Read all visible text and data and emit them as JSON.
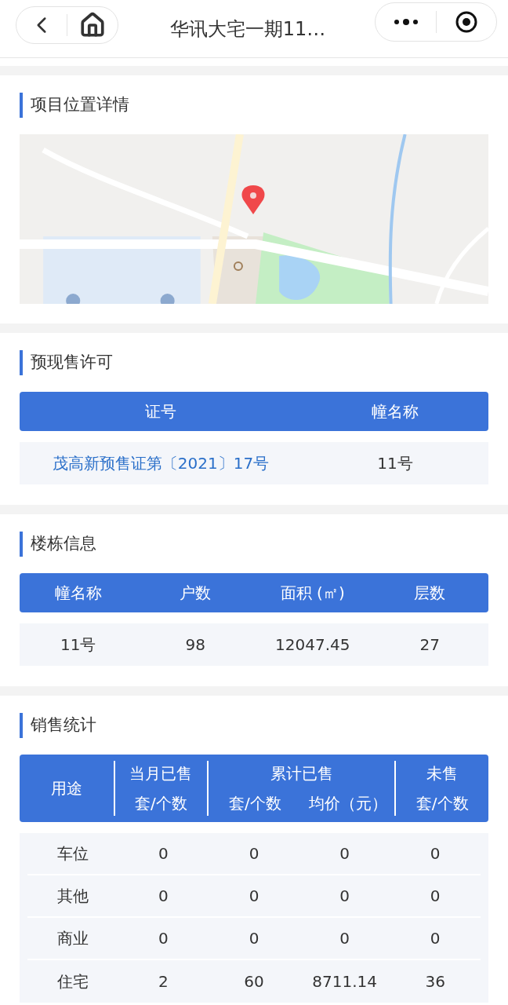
{
  "nav": {
    "title": "华讯大宅一期11…"
  },
  "location": {
    "title": "项目位置详情"
  },
  "permit": {
    "title": "预现售许可",
    "columns": [
      "证号",
      "幢名称"
    ],
    "rows": [
      [
        {
          "text": "茂高新预售证第〔2021〕17号",
          "link": true
        },
        {
          "text": "11号",
          "link": false
        }
      ]
    ]
  },
  "building": {
    "title": "楼栋信息",
    "columns": [
      "幢名称",
      "户数",
      "面积 (㎡)",
      "层数"
    ],
    "rows": [
      [
        "11号",
        "98",
        "12047.45",
        "27"
      ]
    ]
  },
  "sales": {
    "title": "销售统计",
    "columns": [
      {
        "label": "用途"
      },
      {
        "group": "当月已售",
        "label": "套/个数"
      },
      {
        "group": "累计已售",
        "label": "套/个数"
      },
      {
        "label": "均价（元）"
      },
      {
        "group": "未售",
        "label": "套/个数"
      }
    ],
    "rows": [
      [
        "车位",
        "0",
        "0",
        "0",
        "0"
      ],
      [
        "其他",
        "0",
        "0",
        "0",
        "0"
      ],
      [
        "商业",
        "0",
        "0",
        "0",
        "0"
      ],
      [
        "住宅",
        "2",
        "60",
        "8711.14",
        "36"
      ]
    ]
  }
}
